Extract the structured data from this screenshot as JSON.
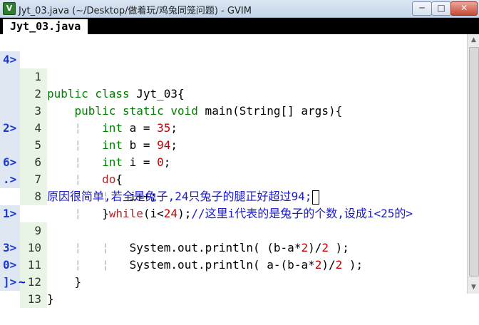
{
  "window": {
    "title": "Jyt_03.java (~/Desktop/做着玩/鸡兔同笼问题) - GVIM",
    "min": "─",
    "max": "□",
    "close": "✕"
  },
  "tab": {
    "label": "Jyt_03.java"
  },
  "fold_marks": {
    "l1": "4>",
    "l5": "2>",
    "l7": "6>",
    "l8": ".>",
    "l9": "1>",
    "l11": "3>",
    "l12": "0>",
    "l13": "]>"
  },
  "line_numbers": [
    "1",
    "2",
    "3",
    "4",
    "5",
    "6",
    "7",
    "8",
    "",
    "9",
    "10",
    "11",
    "12",
    "13"
  ],
  "code": {
    "l1": {
      "kw": "public class",
      "rest": " Jyt_03{"
    },
    "l2": {
      "kw": "public static void",
      "rest": " main(String[] args){"
    },
    "l3": {
      "kw": "int",
      "rest": " a = ",
      "num": "35",
      "end": ";"
    },
    "l4": {
      "kw": "int",
      "rest": " b = ",
      "num": "94",
      "end": ";"
    },
    "l5": {
      "kw": "int",
      "rest": " i = ",
      "num": "0",
      "end": ";"
    },
    "l6": {
      "ctl": "do",
      "rest": "{"
    },
    "l7": {
      "rest": "i++;"
    },
    "l8": {
      "pre": "}",
      "ctl": "while",
      "mid": "(i<",
      "num": "24",
      "end": ");",
      "comment": "//这里i代表的是兔子的个数,设成i<25的>"
    },
    "l8b": {
      "comment": "原因很简单,若全是兔子,24只兔子的腿正好超过94;"
    },
    "l9": {
      "a": "System.out.println( (b-a*",
      "n1": "2",
      "b": ")/",
      "n2": "2",
      "c": " );"
    },
    "l10": {
      "a": "System.out.println( a-(b-a*",
      "n1": "2",
      "b": ")/",
      "n2": "2",
      "c": " );"
    },
    "l11": {
      "rest": "}"
    },
    "l12": {
      "rest": "}"
    }
  },
  "empty_marker": "~"
}
